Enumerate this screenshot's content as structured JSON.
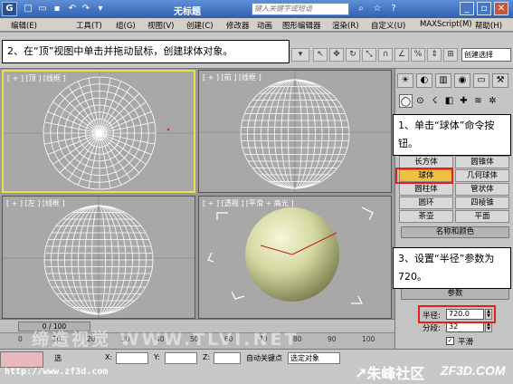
{
  "titlebar": {
    "logo": "G",
    "title": "无标题",
    "search_placeholder": "键入关键字或短语",
    "quick_icons": [
      "↶",
      "↷",
      "▾"
    ]
  },
  "menu": [
    "编辑(E)",
    "工具(T)",
    "组(G)",
    "视图(V)",
    "创建(C)",
    "修改器",
    "动画",
    "图形编辑器",
    "渲染(R)",
    "自定义(U)",
    "MAXScript(M)",
    "帮助(H)"
  ],
  "toolbar": {
    "dropdown_create_selection": "创建选择",
    "scale_label": "1"
  },
  "viewports": [
    {
      "label": "[ + ] [顶 ] [线框 ]",
      "view": "top"
    },
    {
      "label": "[ + ] [前 ] [线框 ]",
      "view": "front"
    },
    {
      "label": "[ + ] [左 ] [线框 ]",
      "view": "left"
    },
    {
      "label": "[ + ] [透视 ] [平滑 + 高光 ]",
      "view": "perspective"
    }
  ],
  "command_panel": {
    "object_buttons": [
      "长方体",
      "圆锥体",
      "球体",
      "几何球体",
      "圆柱体",
      "管状体",
      "圆环",
      "四棱锥",
      "茶壶",
      "平面"
    ],
    "selected_button": "球体",
    "rollout_name_color": "名称和颜色",
    "rollout_params": "参数",
    "radius_label": "半径:",
    "radius_value": "720.0",
    "segments_label": "分段:",
    "segments_value": "32",
    "smooth_label": "平滑",
    "smooth_checked": true
  },
  "timeline": {
    "frame_counter": "0 / 100",
    "ticks": [
      "0",
      "10",
      "20",
      "30",
      "40",
      "50",
      "60",
      "70",
      "80",
      "90",
      "100"
    ]
  },
  "statusbar": {
    "selected_label": "选",
    "x_label": "X:",
    "y_label": "Y:",
    "z_label": "Z:",
    "auto_key": "自动关键点",
    "selected_obj": "选定对象"
  },
  "callouts": {
    "step1": "1、单击“球体”命令按钮。",
    "step2": "2、在“顶”视图中单击并拖动鼠标，创建球体对象。",
    "step3": "3、设置“半径”参数为 720。"
  },
  "watermarks": {
    "url": "http://www.zf3d.com",
    "middle": "缔造视觉 WWW.TLVI.NET",
    "brand_cn": "朱峰社区",
    "brand_en": "ZF3D.COM"
  },
  "colors": {
    "highlight": "#e02020",
    "sphere_fill": "#d8dca8",
    "wire": "#ffffff"
  }
}
